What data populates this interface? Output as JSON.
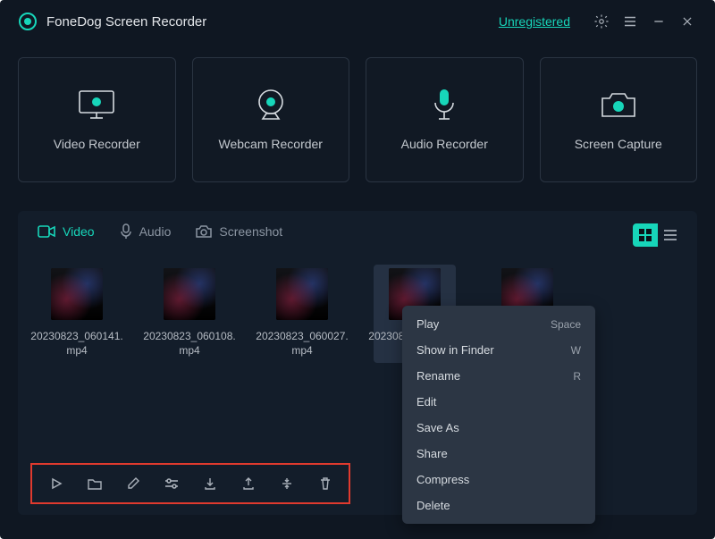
{
  "header": {
    "app_title": "FoneDog Screen Recorder",
    "unregistered_label": "Unregistered"
  },
  "modes": [
    {
      "id": "video",
      "label": "Video Recorder"
    },
    {
      "id": "webcam",
      "label": "Webcam Recorder"
    },
    {
      "id": "audio",
      "label": "Audio Recorder"
    },
    {
      "id": "capture",
      "label": "Screen Capture"
    }
  ],
  "library": {
    "tabs": {
      "video": "Video",
      "audio": "Audio",
      "screenshot": "Screenshot"
    },
    "items": [
      {
        "filename": "20230823_060141.mp4",
        "selected": false
      },
      {
        "filename": "20230823_060108.mp4",
        "selected": false
      },
      {
        "filename": "20230823_060027.mp4",
        "selected": false
      },
      {
        "filename": "20230823_055932.mp4",
        "selected": true
      },
      {
        "filename": "",
        "selected": false
      }
    ]
  },
  "context_menu": [
    {
      "label": "Play",
      "shortcut": "Space"
    },
    {
      "label": "Show in Finder",
      "shortcut": "W"
    },
    {
      "label": "Rename",
      "shortcut": "R"
    },
    {
      "label": "Edit",
      "shortcut": ""
    },
    {
      "label": "Save As",
      "shortcut": ""
    },
    {
      "label": "Share",
      "shortcut": ""
    },
    {
      "label": "Compress",
      "shortcut": ""
    },
    {
      "label": "Delete",
      "shortcut": ""
    }
  ],
  "toolbar_icons": [
    "play-icon",
    "folder-icon",
    "edit-icon",
    "adjust-icon",
    "save-icon",
    "share-icon",
    "compress-icon",
    "trash-icon"
  ]
}
